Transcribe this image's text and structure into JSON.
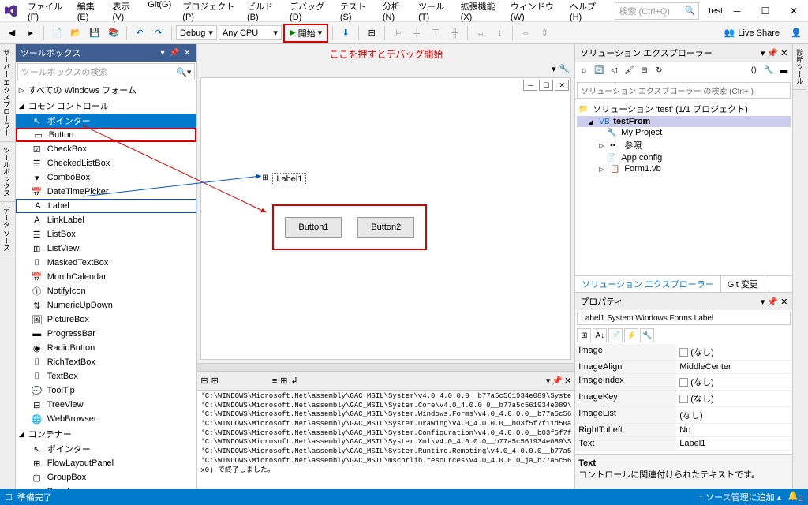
{
  "title": "test",
  "menu": [
    "ファイル(F)",
    "編集(E)",
    "表示(V)",
    "Git(G)",
    "プロジェクト(P)",
    "ビルド(B)",
    "デバッグ(D)",
    "テスト(S)",
    "分析(N)",
    "ツール(T)",
    "拡張機能(X)",
    "ウィンドウ(W)",
    "ヘルプ(H)"
  ],
  "search_placeholder": "検索 (Ctrl+Q)",
  "toolbar": {
    "config": "Debug",
    "platform": "Any CPU",
    "start": "開始",
    "live_share": "Live Share"
  },
  "annotation": "ここを押すとデバッグ開始",
  "toolbox": {
    "title": "ツールボックス",
    "search_placeholder": "ツールボックスの検索",
    "categories": [
      {
        "label": "すべての Windows フォーム",
        "expanded": false
      },
      {
        "label": "コモン コントロール",
        "expanded": true,
        "items": [
          {
            "label": "ポインター",
            "icon": "↖",
            "selected": true
          },
          {
            "label": "Button",
            "icon": "▭",
            "redbox": true
          },
          {
            "label": "CheckBox",
            "icon": "☑"
          },
          {
            "label": "CheckedListBox",
            "icon": "☰"
          },
          {
            "label": "ComboBox",
            "icon": "▾"
          },
          {
            "label": "DateTimePicker",
            "icon": "📅"
          },
          {
            "label": "Label",
            "icon": "A",
            "bluebox": true
          },
          {
            "label": "LinkLabel",
            "icon": "A"
          },
          {
            "label": "ListBox",
            "icon": "☰"
          },
          {
            "label": "ListView",
            "icon": "⊞"
          },
          {
            "label": "MaskedTextBox",
            "icon": "⌷"
          },
          {
            "label": "MonthCalendar",
            "icon": "📅"
          },
          {
            "label": "NotifyIcon",
            "icon": "ⓘ"
          },
          {
            "label": "NumericUpDown",
            "icon": "⇅"
          },
          {
            "label": "PictureBox",
            "icon": "🖼"
          },
          {
            "label": "ProgressBar",
            "icon": "▬"
          },
          {
            "label": "RadioButton",
            "icon": "◉"
          },
          {
            "label": "RichTextBox",
            "icon": "⌷"
          },
          {
            "label": "TextBox",
            "icon": "⌷"
          },
          {
            "label": "ToolTip",
            "icon": "💬"
          },
          {
            "label": "TreeView",
            "icon": "⊟"
          },
          {
            "label": "WebBrowser",
            "icon": "🌐"
          }
        ]
      },
      {
        "label": "コンテナー",
        "expanded": true,
        "items": [
          {
            "label": "ポインター",
            "icon": "↖"
          },
          {
            "label": "FlowLayoutPanel",
            "icon": "⊞"
          },
          {
            "label": "GroupBox",
            "icon": "▢"
          },
          {
            "label": "Panel",
            "icon": "▢"
          }
        ]
      }
    ]
  },
  "designer": {
    "label_text": "Label1",
    "button1": "Button1",
    "button2": "Button2"
  },
  "output": {
    "lines": [
      "'C:\\WINDOWS\\Microsoft.Net\\assembly\\GAC_MSIL\\System\\v4.0_4.0.0.0__b77a5c561934e089\\Syste",
      "'C:\\WINDOWS\\Microsoft.Net\\assembly\\GAC_MSIL\\System.Core\\v4.0_4.0.0.0__b77a5c561934e089\\",
      "'C:\\WINDOWS\\Microsoft.Net\\assembly\\GAC_MSIL\\System.Windows.Forms\\v4.0_4.0.0.0__b77a5c56",
      "'C:\\WINDOWS\\Microsoft.Net\\assembly\\GAC_MSIL\\System.Drawing\\v4.0_4.0.0.0__b03f5f7f11d50a",
      "'C:\\WINDOWS\\Microsoft.Net\\assembly\\GAC_MSIL\\System.Configuration\\v4.0_4.0.0.0__b03f5f7f",
      "'C:\\WINDOWS\\Microsoft.Net\\assembly\\GAC_MSIL\\System.Xml\\v4.0_4.0.0.0__b77a5c561934e089\\S",
      "'C:\\WINDOWS\\Microsoft.Net\\assembly\\GAC_MSIL\\System.Runtime.Remoting\\v4.0_4.0.0.0__b77a5",
      "'C:\\WINDOWS\\Microsoft.Net\\assembly\\GAC_MSIL\\mscorlib.resources\\v4.0_4.0.0.0_ja_b77a5c56",
      "x0) で終了しました。"
    ]
  },
  "solution_explorer": {
    "title": "ソリューション エクスプローラー",
    "search_placeholder": "ソリューション エクスプローラー の検索 (Ctrl+;)",
    "root": "ソリューション 'test' (1/1 プロジェクト)",
    "project": "testFrom",
    "nodes": [
      "My Project",
      "参照",
      "App.config",
      "Form1.vb"
    ],
    "tabs": [
      "ソリューション エクスプローラー",
      "Git 変更"
    ]
  },
  "properties": {
    "title": "プロパティ",
    "selector": "Label1 System.Windows.Forms.Label",
    "rows": [
      {
        "name": "Image",
        "value": "(なし)",
        "checkbox": true
      },
      {
        "name": "ImageAlign",
        "value": "MiddleCenter"
      },
      {
        "name": "ImageIndex",
        "value": "(なし)",
        "checkbox": true
      },
      {
        "name": "ImageKey",
        "value": "(なし)",
        "checkbox": true
      },
      {
        "name": "ImageList",
        "value": "(なし)"
      },
      {
        "name": "RightToLeft",
        "value": "No"
      },
      {
        "name": "Text",
        "value": "Label1"
      }
    ],
    "desc_name": "Text",
    "desc_text": "コントロールに関連付けられたテキストです。"
  },
  "statusbar": {
    "ready": "準備完了",
    "source_control": "ソース管理に追加"
  },
  "left_vtabs": [
    "サーバー エクスプローラー",
    "ツールボックス",
    "データ ソース"
  ],
  "right_vtab": "診断ツール"
}
